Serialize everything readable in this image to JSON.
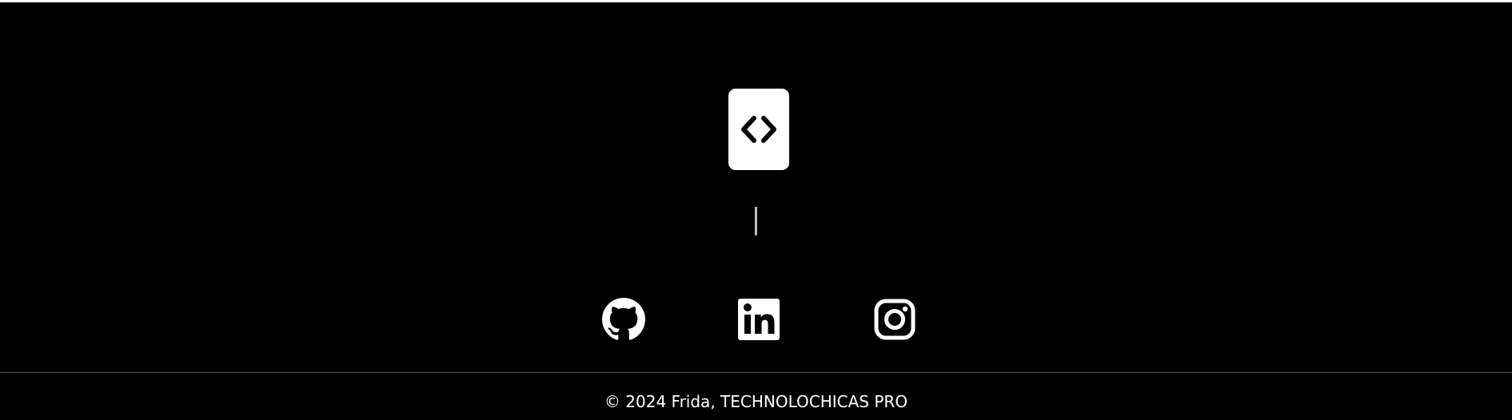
{
  "footer": {
    "logo_icon": "code-brackets-icon",
    "divider": "|",
    "social": [
      {
        "name": "GitHub",
        "icon": "github-icon"
      },
      {
        "name": "LinkedIn",
        "icon": "linkedin-icon"
      },
      {
        "name": "Instagram",
        "icon": "instagram-icon"
      }
    ],
    "copyright": "© 2024 Frida, TECHNOLOCHICAS PRO"
  },
  "colors": {
    "background": "#000000",
    "foreground": "#ffffff",
    "divider": "#bfbfbf",
    "rule": "#4d4d4d"
  }
}
